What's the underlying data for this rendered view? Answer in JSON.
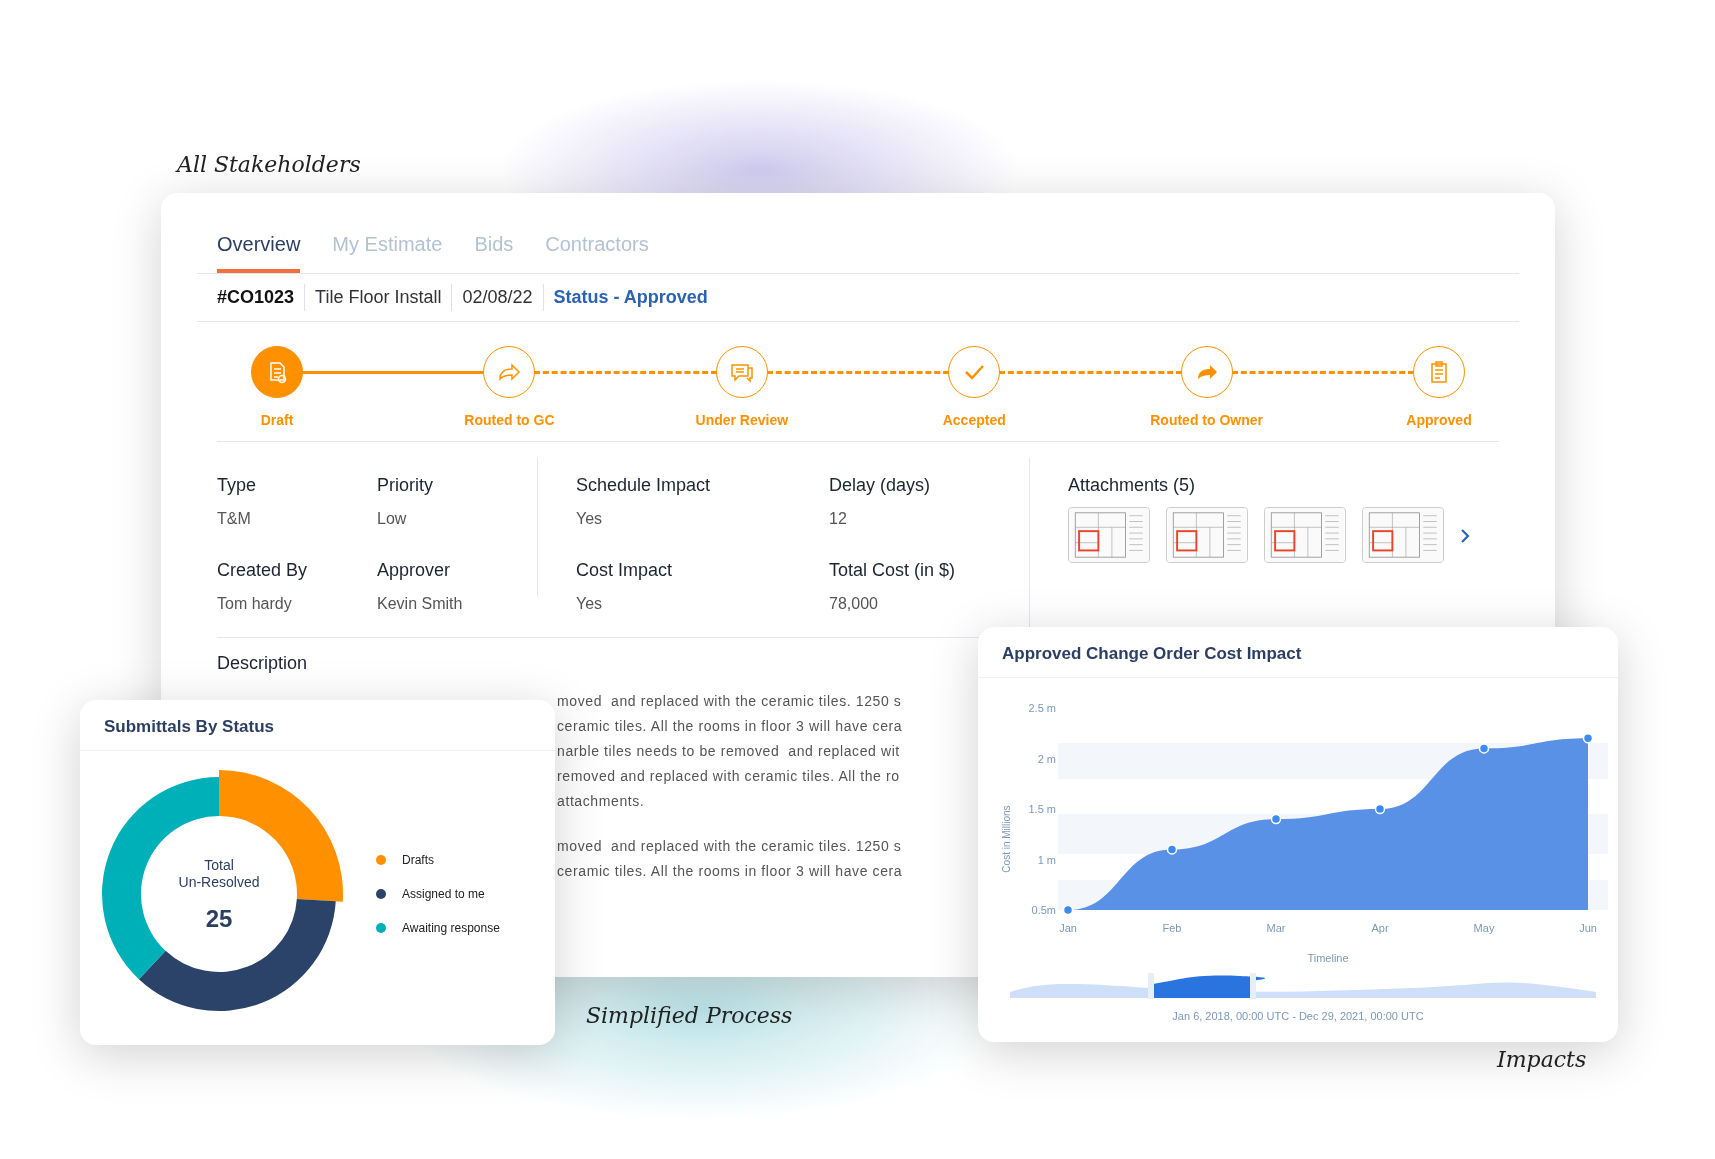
{
  "captions": [
    "All Stakeholders",
    "Simplified Process",
    "Impacts"
  ],
  "tabs": [
    {
      "label": "Overview",
      "selected": true
    },
    {
      "label": "My Estimate",
      "selected": false
    },
    {
      "label": "Bids",
      "selected": false
    },
    {
      "label": "Contractors",
      "selected": false
    }
  ],
  "header": {
    "id": "#CO1023",
    "name": "Tile Floor Install",
    "date": "02/08/22",
    "status": "Status - Approved"
  },
  "steps": [
    {
      "label": "Draft",
      "active": true
    },
    {
      "label": "Routed to GC",
      "active": false
    },
    {
      "label": "Under Review",
      "active": false
    },
    {
      "label": "Accepted",
      "active": false
    },
    {
      "label": "Routed to Owner",
      "active": false
    },
    {
      "label": "Approved",
      "active": false
    }
  ],
  "details": [
    [
      {
        "label": "Type",
        "value": "T&M"
      },
      {
        "label": "Priority",
        "value": "Low"
      },
      {
        "label": "Created By",
        "value": "Tom hardy"
      },
      {
        "label": "Approver",
        "value": "Kevin Smith"
      }
    ],
    [
      {
        "label": "Schedule Impact",
        "value": "Yes"
      },
      {
        "label": "Delay (days)",
        "value": "12"
      },
      {
        "label": "Cost Impact",
        "value": "Yes"
      },
      {
        "label": "Total Cost (in $)",
        "value": "78,000"
      }
    ]
  ],
  "attachments": {
    "title": "Attachments (5)"
  },
  "description": {
    "title": "Description",
    "paragraphs": [
      [
        "moved  and replaced with the ceramic tiles. 1250 s",
        "ceramic tiles. All the rooms in floor 3 will have cera",
        "narble tiles needs to be removed  and replaced wit",
        "removed and replaced with ceramic tiles. All the ro",
        "attachments."
      ],
      [
        "moved  and replaced with the ceramic tiles. 1250 s",
        "ceramic tiles. All the rooms in floor 3 will have cera"
      ]
    ]
  },
  "submittals": {
    "title": "Submittals By Status",
    "center_label": [
      "Total",
      "Un-Resolved"
    ],
    "total": "25",
    "legend": [
      {
        "color": "#ff9100"
      },
      {
        "color": "#2b4269"
      },
      {
        "color": "#00b0b9"
      }
    ],
    "chart_data": {
      "type": "donut",
      "categories": [
        "Drafts",
        "Assigned to me",
        "Awaiting response"
      ],
      "values": [
        26,
        36,
        38
      ]
    }
  },
  "cost_impact": {
    "title": "Approved Change Order Cost Impact",
    "range": "Jan 6, 2018, 00:00 UTC - Dec 29, 2021, 00:00 UTC",
    "chart_data": {
      "type": "area",
      "xlabel": "Timeline",
      "ylabel": "Cost in Millions",
      "categories": [
        "Jan",
        "Feb",
        "Mar",
        "Apr",
        "May",
        "Jun"
      ],
      "series": [
        {
          "color": "#5891e6",
          "values": [
            0.5,
            1.1,
            1.4,
            1.5,
            2.1,
            2.2
          ]
        }
      ],
      "ylim": [
        0.5,
        2.5
      ],
      "yticks": [
        {
          "value": 0.5,
          "label": "0.5m"
        },
        {
          "value": 1,
          "label": "1 m"
        },
        {
          "value": 1.5,
          "label": "1.5 m"
        },
        {
          "value": 2,
          "label": "2 m"
        },
        {
          "value": 2.5,
          "label": "2.5 m"
        }
      ]
    }
  }
}
